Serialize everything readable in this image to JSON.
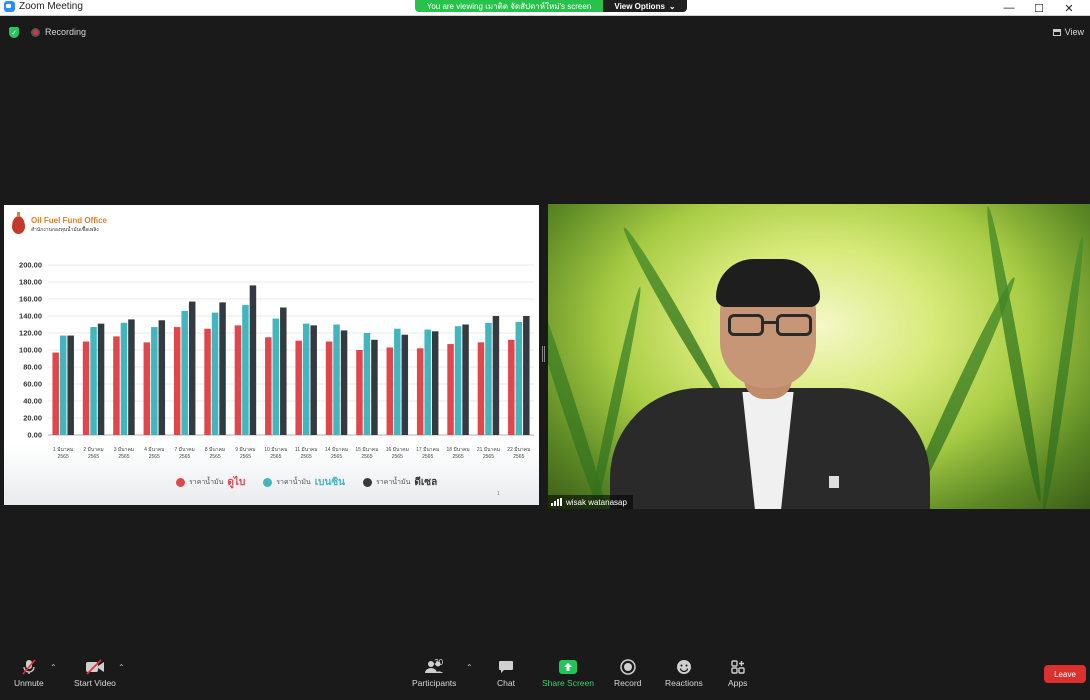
{
  "window": {
    "title": "Zoom Meeting"
  },
  "banner": {
    "viewing_text": "You are viewing เมาติด จัดสัปดาห์ใหม่'s screen",
    "view_options": "View Options"
  },
  "status": {
    "recording": "Recording",
    "view": "View"
  },
  "slide": {
    "org_name_en": "Oil Fuel Fund Office",
    "org_name_th": "สำนักงานกองทุนน้ำมันเชื้อเพลิง",
    "page_number": "1"
  },
  "chart_data": {
    "type": "bar",
    "categories": [
      "1 มีนาคม 2565",
      "2 มีนาคม 2565",
      "3 มีนาคม 2565",
      "4 มีนาคม 2565",
      "7 มีนาคม 2565",
      "8 มีนาคม 2565",
      "9 มีนาคม 2565",
      "10 มีนาคม 2565",
      "11 มีนาคม 2565",
      "14 มีนาคม 2565",
      "15 มีนาคม 2565",
      "16 มีนาคม 2565",
      "17 มีนาคม 2565",
      "18 มีนาคม 2565",
      "21 มีนาคม 2565",
      "22 มีนาคม 2565"
    ],
    "series": [
      {
        "name": "ราคาน้ำมัน ดูไบ",
        "color": "#e0474c",
        "values": [
          97,
          110,
          116,
          109,
          127,
          125,
          129,
          115,
          111,
          110,
          100,
          103,
          102,
          107,
          109,
          112
        ]
      },
      {
        "name": "ราคาน้ำมัน เบนซิน",
        "color": "#43b5bf",
        "values": [
          117,
          127,
          132,
          127,
          146,
          144,
          153,
          137,
          131,
          130,
          120,
          125,
          124,
          128,
          132,
          133
        ]
      },
      {
        "name": "ราคาน้ำมัน ดีเซล",
        "color": "#333a40",
        "values": [
          117,
          131,
          136,
          135,
          157,
          156,
          176,
          150,
          129,
          123,
          112,
          118,
          122,
          130,
          140,
          140
        ]
      }
    ],
    "legend": [
      {
        "prefix": "ราคาน้ำมัน",
        "emphasis": "ดูไบ",
        "color": "#e0474c"
      },
      {
        "prefix": "ราคาน้ำมัน",
        "emphasis": "เบนซิน",
        "color": "#43b5bf"
      },
      {
        "prefix": "ราคาน้ำมัน",
        "emphasis": "ดีเซล",
        "color": "#333a40"
      }
    ],
    "yticks": [
      "0.00",
      "20.00",
      "40.00",
      "60.00",
      "80.00",
      "100.00",
      "120.00",
      "140.00",
      "160.00",
      "180.00",
      "200.00"
    ],
    "ylim": [
      0,
      200
    ],
    "grid": true,
    "legend_position": "bottom"
  },
  "video": {
    "participant_name": "wisak watanasap"
  },
  "toolbar": {
    "unmute": "Unmute",
    "start_video": "Start Video",
    "participants": "Participants",
    "participants_count": "30",
    "chat": "Chat",
    "share_screen": "Share Screen",
    "record": "Record",
    "reactions": "Reactions",
    "apps": "Apps",
    "leave": "Leave"
  }
}
